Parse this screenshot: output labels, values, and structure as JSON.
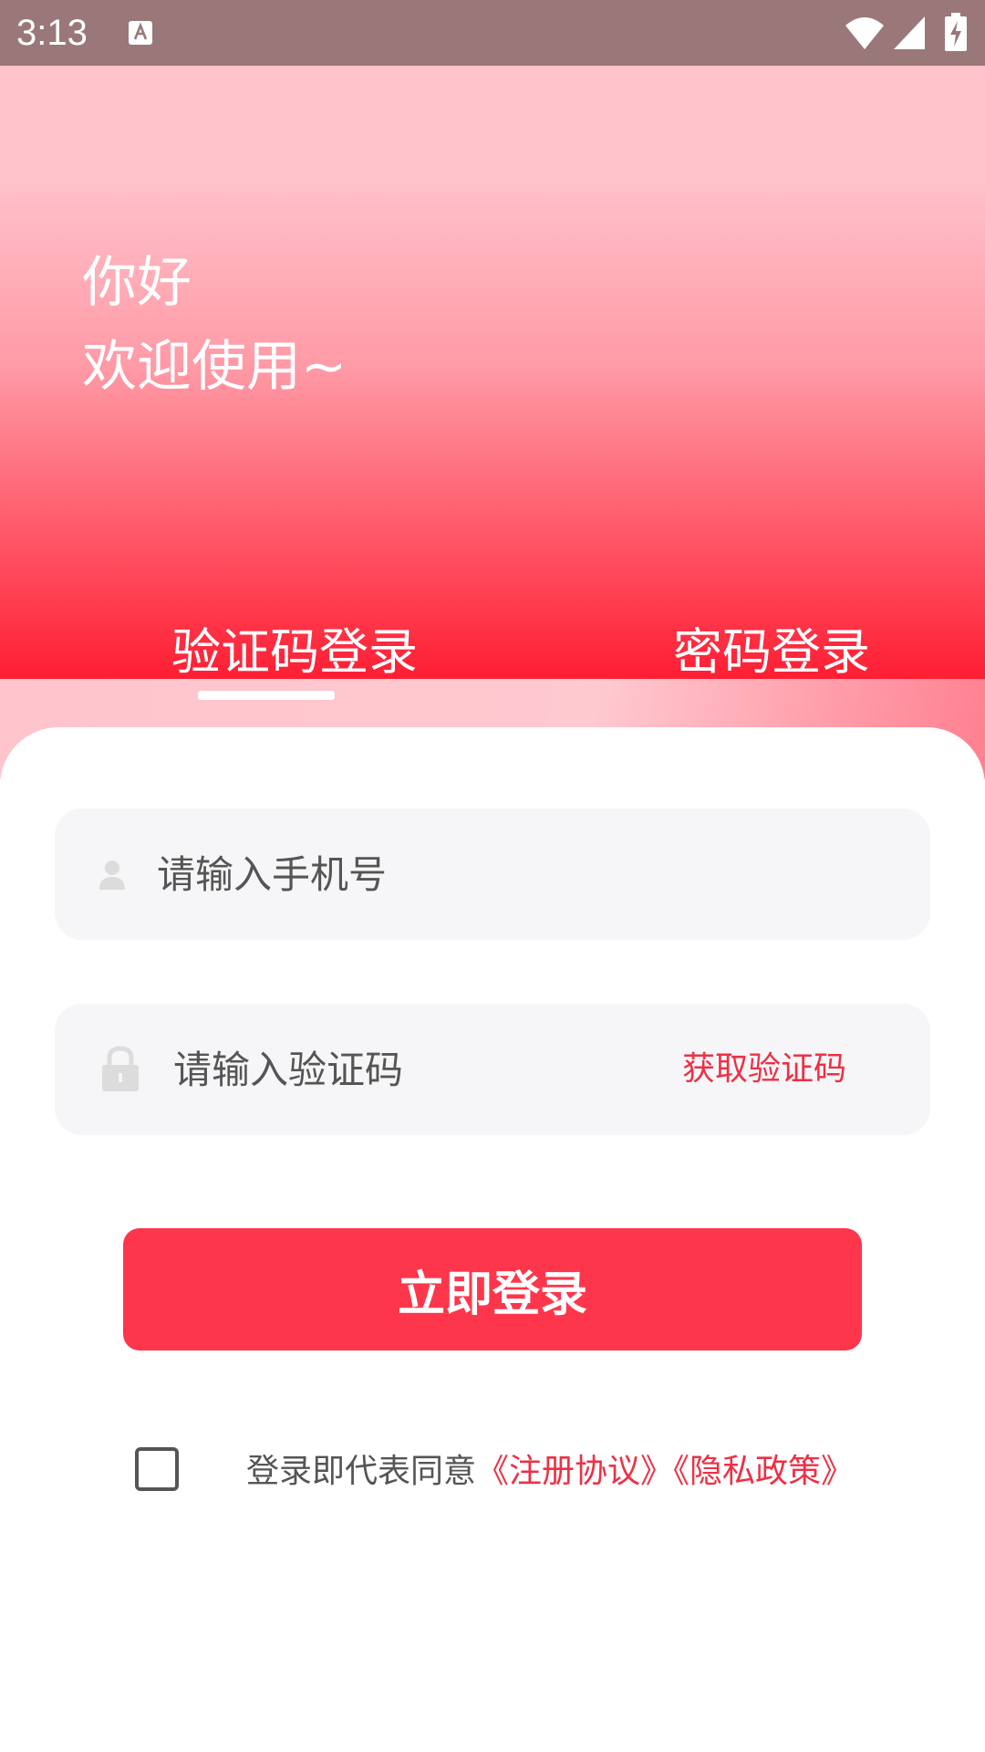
{
  "status_bar": {
    "time": "3:13"
  },
  "hero": {
    "greeting_line1": "你好",
    "greeting_line2": "欢迎使用~"
  },
  "tabs": [
    {
      "label": "验证码登录",
      "active": true
    },
    {
      "label": "密码登录",
      "active": false
    }
  ],
  "form": {
    "phone_placeholder": "请输入手机号",
    "code_placeholder": "请输入验证码",
    "get_code_label": "获取验证码",
    "login_label": "立即登录"
  },
  "agreement": {
    "prefix": "登录即代表同意",
    "terms": "《注册协议》",
    "privacy": "《隐私政策》"
  },
  "colors": {
    "accent": "#fe364b",
    "link": "#ee3045",
    "status_bar": "#9a7779"
  },
  "icons": [
    "a-notification-icon",
    "wifi-icon",
    "signal-icon",
    "battery-charging-icon",
    "user-icon",
    "lock-icon"
  ]
}
